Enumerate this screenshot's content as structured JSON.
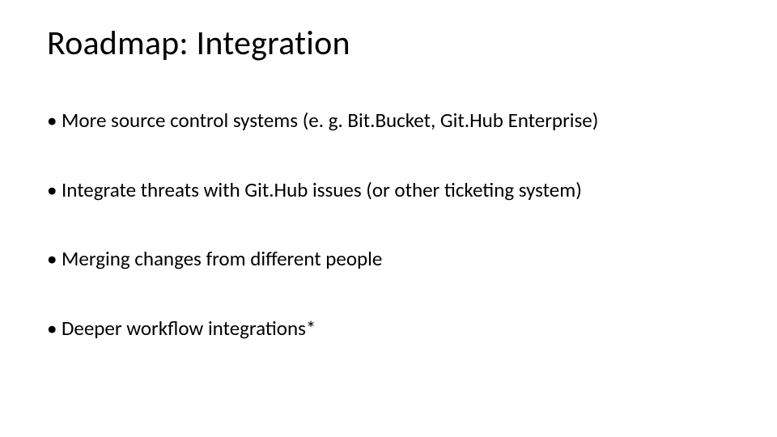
{
  "slide": {
    "title": "Roadmap: Integration",
    "bullets": [
      "More source control systems (e. g. Bit.Bucket, Git.Hub Enterprise)",
      "Integrate threats with Git.Hub issues (or other ticketing system)",
      "Merging changes from different people",
      "Deeper workflow integrations*"
    ]
  }
}
